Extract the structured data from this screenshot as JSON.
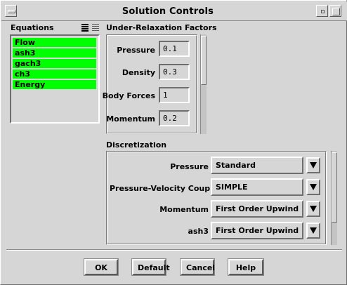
{
  "window": {
    "title": "Solution Controls"
  },
  "equations": {
    "label": "Equations",
    "items": [
      "Flow",
      "ash3",
      "gach3",
      "ch3",
      "Energy"
    ]
  },
  "relaxation": {
    "label": "Under-Relaxation Factors",
    "fields": [
      {
        "label": "Pressure",
        "value": "0.1"
      },
      {
        "label": "Density",
        "value": "0.3"
      },
      {
        "label": "Body Forces",
        "value": "1"
      },
      {
        "label": "Momentum",
        "value": "0.2"
      }
    ]
  },
  "discretization": {
    "label": "Discretization",
    "rows": [
      {
        "label": "Pressure",
        "value": "Standard"
      },
      {
        "label": "Pressure-Velocity Coupling",
        "value": "SIMPLE"
      },
      {
        "label": "Momentum",
        "value": "First Order Upwind"
      },
      {
        "label": "ash3",
        "value": "First Order Upwind"
      }
    ]
  },
  "buttons": {
    "ok": "OK",
    "default": "Default",
    "cancel": "Cancel",
    "help": "Help"
  },
  "colors": {
    "background": "#d6d6d6",
    "selection": "#00ff00"
  },
  "icons": [
    "window-menu-icon",
    "minimize-icon",
    "maximize-icon",
    "select-all-icon",
    "deselect-all-icon",
    "dropdown-arrow-icon"
  ]
}
